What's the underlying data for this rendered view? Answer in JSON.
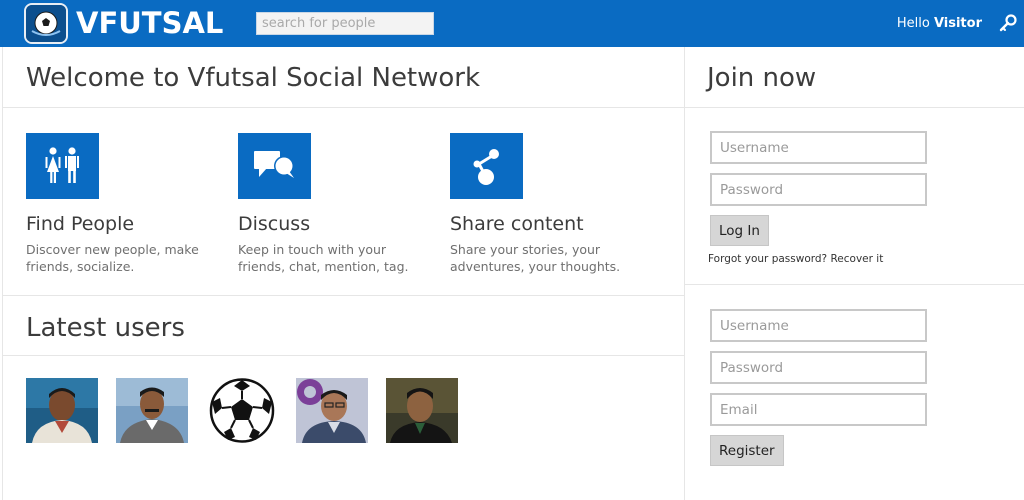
{
  "header": {
    "brand": "VFUTSAL",
    "search_placeholder": "search for people",
    "greeting": "Hello",
    "user": "Visitor"
  },
  "main": {
    "welcome_title": "Welcome to Vfutsal Social Network",
    "features": [
      {
        "icon": "people-icon",
        "title": "Find People",
        "description": "Discover new people, make friends, socialize."
      },
      {
        "icon": "chat-bubbles-icon",
        "title": "Discuss",
        "description": "Keep in touch with your friends, chat, mention, tag."
      },
      {
        "icon": "share-icon",
        "title": "Share content",
        "description": "Share your stories, your adventures, your thoughts."
      }
    ],
    "latest_title": "Latest users",
    "latest_users_count": 5
  },
  "sidebar": {
    "join_title": "Join now",
    "login": {
      "username_placeholder": "Username",
      "password_placeholder": "Password",
      "button": "Log In",
      "forgot_text": "Forgot your password?",
      "recover_link": "Recover it"
    },
    "register": {
      "username_placeholder": "Username",
      "password_placeholder": "Password",
      "email_placeholder": "Email",
      "button": "Register"
    }
  },
  "colors": {
    "brand_blue": "#0a6bc2",
    "button_gray": "#d6d6d6"
  }
}
